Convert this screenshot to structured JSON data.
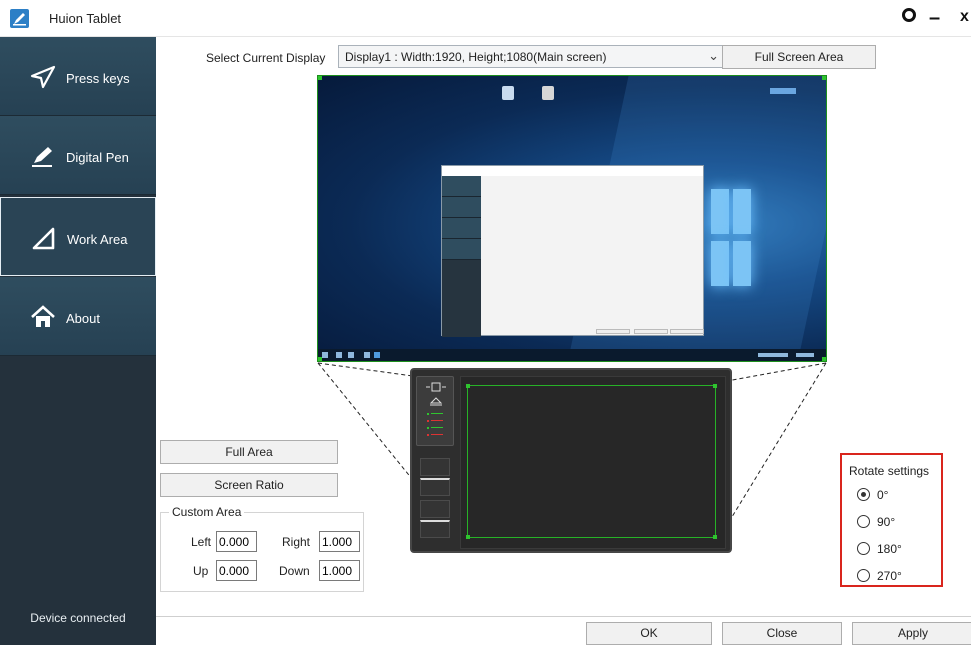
{
  "window": {
    "title": "Huion Tablet",
    "minimize_glyph": "–",
    "close_glyph": "x"
  },
  "sidebar": {
    "items": [
      {
        "label": "Press keys",
        "icon": "paper-plane-icon"
      },
      {
        "label": "Digital Pen",
        "icon": "pen-icon"
      },
      {
        "label": "Work Area",
        "icon": "work-area-icon",
        "active": true
      },
      {
        "label": "About",
        "icon": "home-icon"
      }
    ],
    "device_status": "Device connected"
  },
  "display": {
    "select_label": "Select Current Display",
    "selected_value": "Display1 : Width:1920, Height;1080(Main screen)",
    "full_screen_button": "Full Screen Area"
  },
  "area": {
    "full_area_button": "Full Area",
    "screen_ratio_button": "Screen Ratio",
    "custom_title": "Custom Area",
    "left_label": "Left",
    "left_value": "0.000",
    "right_label": "Right",
    "right_value": "1.000",
    "up_label": "Up",
    "up_value": "0.000",
    "down_label": "Down",
    "down_value": "1.000"
  },
  "rotate": {
    "title": "Rotate settings",
    "options": [
      "0°",
      "90°",
      "180°",
      "270°"
    ],
    "selected": "0°"
  },
  "footer": {
    "ok": "OK",
    "close": "Close",
    "apply": "Apply"
  },
  "colors": {
    "sidebar_bg": "#24313c",
    "nav_item_bg": "#2f4d5f",
    "area_outline": "#1d8f1d",
    "highlight_box": "#d9251d"
  }
}
